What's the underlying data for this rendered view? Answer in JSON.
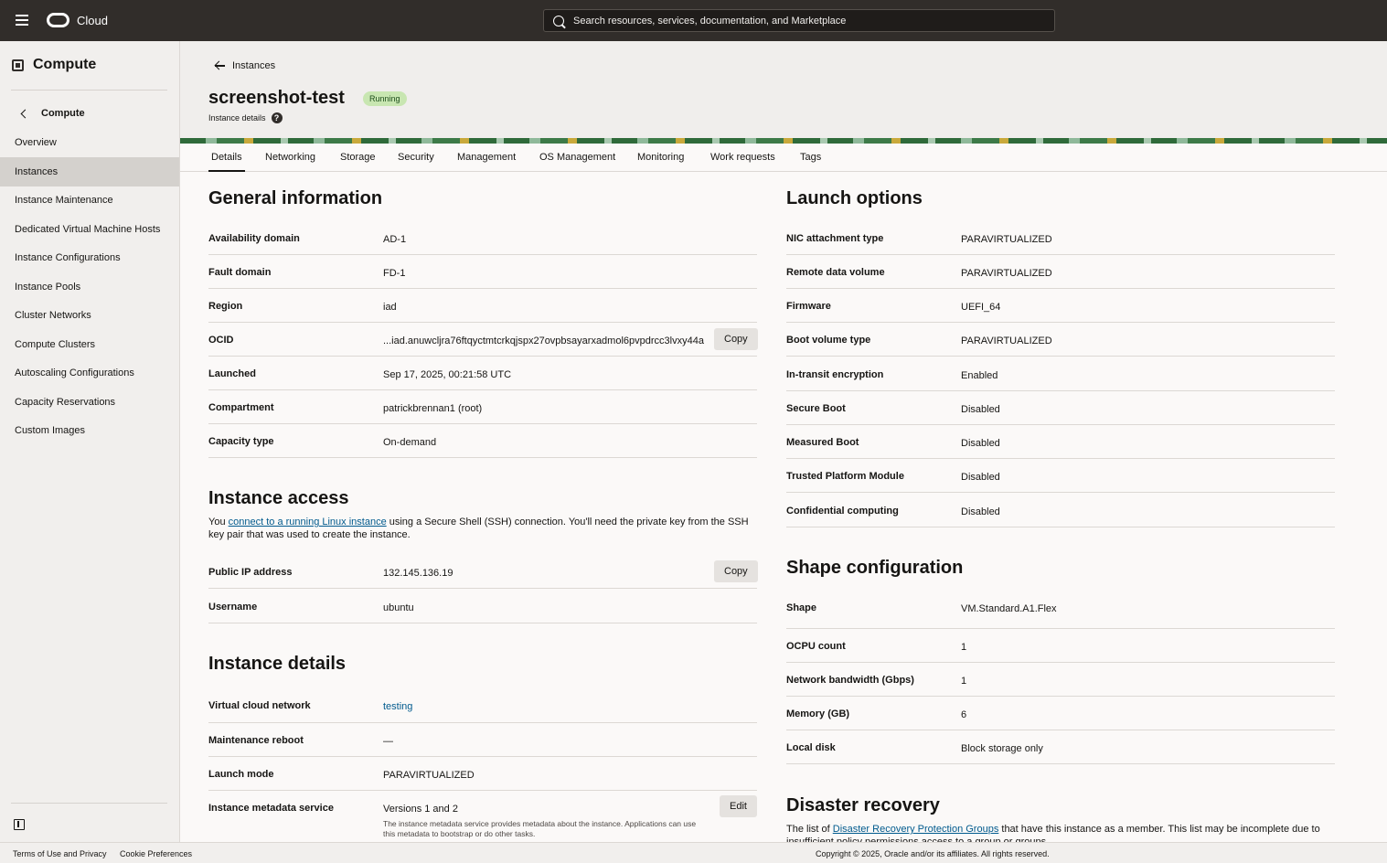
{
  "topbar": {
    "brand": "Cloud",
    "search_placeholder": "Search resources, services, documentation, and Marketplace"
  },
  "sidebar": {
    "title": "Compute",
    "back_label": "Compute",
    "items": [
      {
        "label": "Overview"
      },
      {
        "label": "Instances"
      },
      {
        "label": "Instance Maintenance"
      },
      {
        "label": "Dedicated Virtual Machine Hosts"
      },
      {
        "label": "Instance Configurations"
      },
      {
        "label": "Instance Pools"
      },
      {
        "label": "Cluster Networks"
      },
      {
        "label": "Compute Clusters"
      },
      {
        "label": "Autoscaling Configurations"
      },
      {
        "label": "Capacity Reservations"
      },
      {
        "label": "Custom Images"
      }
    ]
  },
  "header": {
    "breadcrumb": "Instances",
    "title": "screenshot-test",
    "status": "Running",
    "subtitle": "Instance details"
  },
  "tabs": [
    "Details",
    "Networking",
    "Storage",
    "Security",
    "Management",
    "OS Management",
    "Monitoring",
    "Work requests",
    "Tags"
  ],
  "general": {
    "title": "General information",
    "rows": [
      {
        "label": "Availability domain",
        "value": "AD-1"
      },
      {
        "label": "Fault domain",
        "value": "FD-1"
      },
      {
        "label": "Region",
        "value": "iad"
      },
      {
        "label": "OCID",
        "value": "...iad.anuwcljra76ftqyctmtcrkqjspx27ovpbsayarxadmol6pvpdrcc3lvxy44a"
      },
      {
        "label": "Launched",
        "value": "Sep 17, 2025, 00:21:58 UTC"
      },
      {
        "label": "Compartment",
        "value": "patrickbrennan1 (root)"
      },
      {
        "label": "Capacity type",
        "value": "On-demand"
      }
    ],
    "copy_label": "Copy"
  },
  "access": {
    "title": "Instance access",
    "text_before": "You ",
    "link": "connect to a running Linux instance",
    "text_after": " using a Secure Shell (SSH) connection. You'll need the private key from the SSH key pair that was used to create the instance.",
    "rows": [
      {
        "label": "Public IP address",
        "value": "132.145.136.19"
      },
      {
        "label": "Username",
        "value": "ubuntu"
      }
    ],
    "copy_label": "Copy"
  },
  "details": {
    "title": "Instance details",
    "rows": [
      {
        "label": "Virtual cloud network",
        "value": "testing"
      },
      {
        "label": "Maintenance reboot",
        "value": "—"
      },
      {
        "label": "Launch mode",
        "value": "PARAVIRTUALIZED"
      },
      {
        "label": "Instance metadata service",
        "value": "Versions 1 and 2"
      }
    ],
    "metadata_note": "The instance metadata service provides metadata about the instance. Applications can use this metadata to bootstrap or do other tasks.",
    "edit_label": "Edit"
  },
  "launch": {
    "title": "Launch options",
    "rows": [
      {
        "label": "NIC attachment type",
        "value": "PARAVIRTUALIZED"
      },
      {
        "label": "Remote data volume",
        "value": "PARAVIRTUALIZED"
      },
      {
        "label": "Firmware",
        "value": "UEFI_64"
      },
      {
        "label": "Boot volume type",
        "value": "PARAVIRTUALIZED"
      },
      {
        "label": "In-transit encryption",
        "value": "Enabled"
      },
      {
        "label": "Secure Boot",
        "value": "Disabled"
      },
      {
        "label": "Measured Boot",
        "value": "Disabled"
      },
      {
        "label": "Trusted Platform Module",
        "value": "Disabled"
      },
      {
        "label": "Confidential computing",
        "value": "Disabled"
      }
    ]
  },
  "shape": {
    "title": "Shape configuration",
    "rows": [
      {
        "label": "Shape",
        "value": "VM.Standard.A1.Flex"
      },
      {
        "label": "OCPU count",
        "value": "1"
      },
      {
        "label": "Network bandwidth (Gbps)",
        "value": "1"
      },
      {
        "label": "Memory (GB)",
        "value": "6"
      },
      {
        "label": "Local disk",
        "value": "Block storage only"
      }
    ]
  },
  "dr": {
    "title": "Disaster recovery",
    "text_before": "The list of ",
    "link": "Disaster Recovery Protection Groups",
    "text_after": " that have this instance as a member. This list may be incomplete due to insufficient policy permissions access to a group or groups."
  },
  "footer": {
    "terms": "Terms of Use and Privacy",
    "cookies": "Cookie Preferences",
    "copyright": "Copyright © 2025, Oracle and/or its affiliates. All rights reserved."
  },
  "colors": {
    "topbar": "#312d2a",
    "sidebar_active": "#d4d1cd",
    "status_badge": "#c8e6b1",
    "link": "#005a8d"
  }
}
